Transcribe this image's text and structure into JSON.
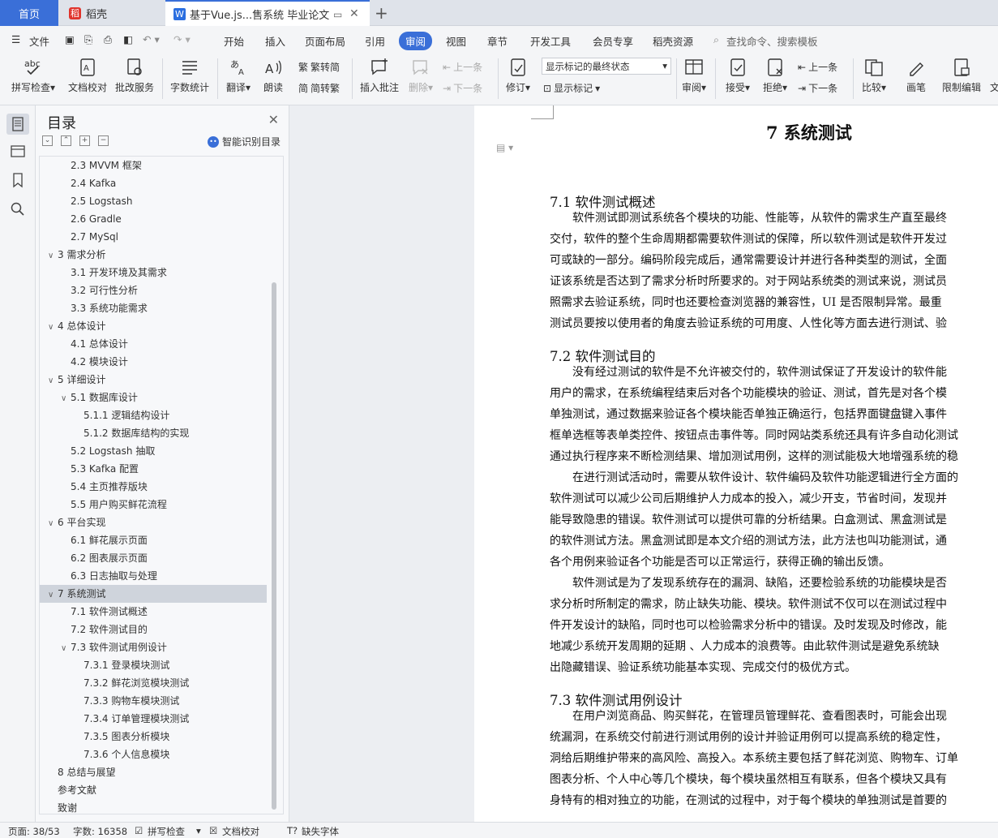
{
  "tabs": {
    "home": "首页",
    "doc1": "稻壳",
    "doc2": "基于Vue.js...售系统 毕业论文"
  },
  "menu": {
    "file": "文件",
    "items": [
      "开始",
      "插入",
      "页面布局",
      "引用",
      "审阅",
      "视图",
      "章节",
      "开发工具",
      "会员专享",
      "稻壳资源"
    ],
    "search": "查找命令、搜索模板"
  },
  "ribbon": {
    "spell": "拼写检查",
    "proof": "文档校对",
    "batch": "批改服务",
    "wordcount": "字数统计",
    "translate": "翻译",
    "read": "朗读",
    "trad": "繁转简",
    "simp": "简转繁",
    "insert_comment": "插入批注",
    "delete": "删除",
    "prev": "上一条",
    "next": "下一条",
    "revise": "修订",
    "markup_select": "显示标记的最终状态",
    "show_markup": "显示标记",
    "review": "审阅",
    "accept": "接受",
    "reject": "拒绝",
    "prev2": "上一条",
    "next2": "下一条",
    "compare": "比较",
    "pen": "画笔",
    "restrict": "限制编辑",
    "doc_cut": "文"
  },
  "toc": {
    "title": "目录",
    "smart": "智能识别目录",
    "items": [
      {
        "t": "2.3 MVVM 框架",
        "lv": 2,
        "c": ""
      },
      {
        "t": "2.4 Kafka",
        "lv": 2,
        "c": ""
      },
      {
        "t": "2.5 Logstash",
        "lv": 2,
        "c": ""
      },
      {
        "t": "2.6 Gradle",
        "lv": 2,
        "c": ""
      },
      {
        "t": "2.7 MySql",
        "lv": 2,
        "c": ""
      },
      {
        "t": "3  需求分析",
        "lv": 1,
        "c": "v"
      },
      {
        "t": "3.1  开发环境及其需求",
        "lv": 2,
        "c": ""
      },
      {
        "t": "3.2  可行性分析",
        "lv": 2,
        "c": ""
      },
      {
        "t": "3.3  系统功能需求",
        "lv": 2,
        "c": ""
      },
      {
        "t": "4  总体设计",
        "lv": 1,
        "c": "v"
      },
      {
        "t": "4.1  总体设计",
        "lv": 2,
        "c": ""
      },
      {
        "t": "4.2  模块设计",
        "lv": 2,
        "c": ""
      },
      {
        "t": "5  详细设计",
        "lv": 1,
        "c": "v"
      },
      {
        "t": "5.1  数据库设计",
        "lv": 2,
        "c": "v"
      },
      {
        "t": "5.1.1  逻辑结构设计",
        "lv": 3,
        "c": ""
      },
      {
        "t": "5.1.2  数据库结构的实现",
        "lv": 3,
        "c": ""
      },
      {
        "t": "5.2 Logstash 抽取",
        "lv": 2,
        "c": ""
      },
      {
        "t": "5.3 Kafka 配置",
        "lv": 2,
        "c": ""
      },
      {
        "t": "5.4  主页推荐版块",
        "lv": 2,
        "c": ""
      },
      {
        "t": "5.5  用户购买鲜花流程",
        "lv": 2,
        "c": ""
      },
      {
        "t": "6  平台实现",
        "lv": 1,
        "c": "v"
      },
      {
        "t": "6.1  鲜花展示页面",
        "lv": 2,
        "c": ""
      },
      {
        "t": "6.2  图表展示页面",
        "lv": 2,
        "c": ""
      },
      {
        "t": "6.3  日志抽取与处理",
        "lv": 2,
        "c": ""
      },
      {
        "t": "7  系统测试",
        "lv": 1,
        "c": "v",
        "sel": true
      },
      {
        "t": "7.1  软件测试概述",
        "lv": 2,
        "c": ""
      },
      {
        "t": "7.2  软件测试目的",
        "lv": 2,
        "c": ""
      },
      {
        "t": "7.3  软件测试用例设计",
        "lv": 2,
        "c": "v"
      },
      {
        "t": "7.3.1  登录模块测试",
        "lv": 3,
        "c": ""
      },
      {
        "t": "7.3.2  鲜花浏览模块测试",
        "lv": 3,
        "c": ""
      },
      {
        "t": "7.3.3  购物车模块测试",
        "lv": 3,
        "c": ""
      },
      {
        "t": "7.3.4  订单管理模块测试",
        "lv": 3,
        "c": ""
      },
      {
        "t": "7.3.5  图表分析模块",
        "lv": 3,
        "c": ""
      },
      {
        "t": "7.3.6  个人信息模块",
        "lv": 3,
        "c": ""
      },
      {
        "t": "8  总结与展望",
        "lv": 1,
        "c": ""
      },
      {
        "t": "参考文献",
        "lv": 1,
        "c": ""
      },
      {
        "t": "致谢",
        "lv": 1,
        "c": ""
      }
    ]
  },
  "doc": {
    "title": "7  系统测试",
    "sections": [
      {
        "h": "7.1  软件测试概述",
        "lines": [
          "　　软件测试即测试系统各个模块的功能、性能等，从软件的需求生产直至最终",
          "交付，软件的整个生命周期都需要软件测试的保障，所以软件测试是软件开发过",
          "可或缺的一部分。编码阶段完成后，通常需要设计并进行各种类型的测试，全面",
          "证该系统是否达到了需求分析时所要求的。对于网站系统类的测试来说，测试员",
          "照需求去验证系统，同时也还要检查浏览器的兼容性，UI 是否限制异常。最重",
          "测试员要按以使用者的角度去验证系统的可用度、人性化等方面去进行测试、验"
        ]
      },
      {
        "h": "7.2  软件测试目的",
        "lines": [
          "　　没有经过测试的软件是不允许被交付的，软件测试保证了开发设计的软件能",
          "用户的需求，在系统编程结束后对各个功能模块的验证、测试，首先是对各个模",
          "单独测试，通过数据来验证各个模块能否单独正确运行，包括界面键盘键入事件",
          "框单选框等表单类控件、按钮点击事件等。同时网站类系统还具有许多自动化测试",
          "通过执行程序来不断检测结果、增加测试用例，这样的测试能极大地增强系统的稳",
          "　　在进行测试活动时，需要从软件设计、软件编码及软件功能逻辑进行全方面的",
          "软件测试可以减少公司后期维护人力成本的投入，减少开支，节省时间，发现并",
          "能导致隐患的错误。软件测试可以提供可靠的分析结果。白盒测试、黑盒测试是",
          "的软件测试方法。黑盒测试即是本文介绍的测试方法，此方法也叫功能测试，通",
          "各个用例来验证各个功能是否可以正常运行，获得正确的输出反馈。",
          "　　软件测试是为了发现系统存在的漏洞、缺陷，还要检验系统的功能模块是否",
          "求分析时所制定的需求，防止缺失功能、模块。软件测试不仅可以在测试过程中",
          "件开发设计的缺陷，同时也可以检验需求分析中的错误。及时发现及时修改，能",
          "地减少系统开发周期的延期  、人力成本的浪费等。由此软件测试是避免系统缺",
          "出隐藏错误、验证系统功能基本实现、完成交付的极优方式。"
        ]
      },
      {
        "h": "7.3  软件测试用例设计",
        "lines": [
          "　　在用户浏览商品、购买鲜花，在管理员管理鲜花、查看图表时，可能会出现",
          "统漏洞，在系统交付前进行测试用例的设计并验证用例可以提高系统的稳定性，",
          "洞给后期维护带来的高风险、高投入。本系统主要包括了鲜花浏览、购物车、订单",
          "图表分析、个人中心等几个模块，每个模块虽然相互有联系，但各个模块又具有",
          "身特有的相对独立的功能，在测试的过程中，对于每个模块的单独测试是首要的"
        ]
      }
    ]
  },
  "status": {
    "page": "页面: 38/53",
    "words": "字数: 16358",
    "spell": "拼写检查",
    "proof": "文档校对",
    "font": "缺失字体"
  }
}
